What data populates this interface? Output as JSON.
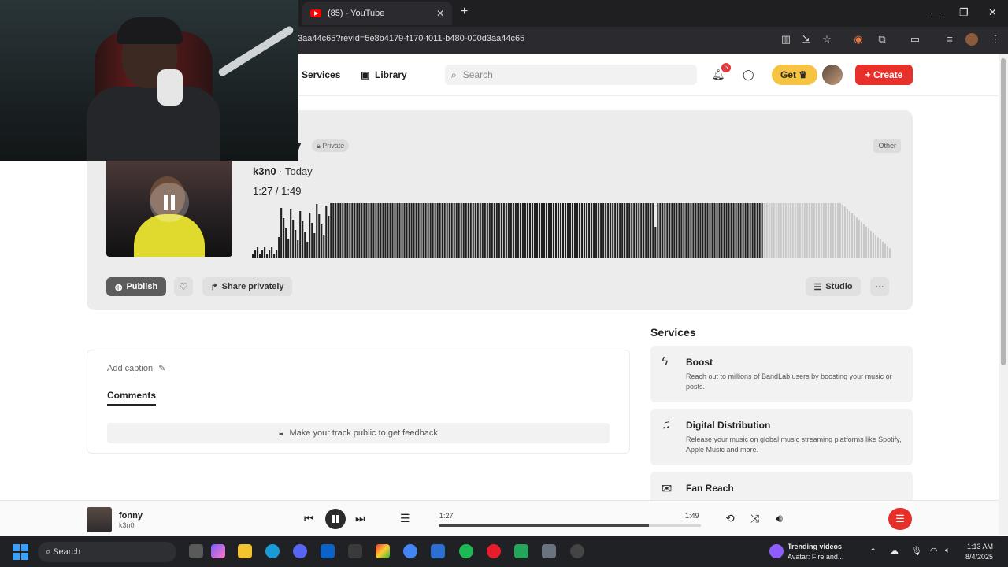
{
  "browser": {
    "tab_title": "(85) - YouTube",
    "tab_close": "✕",
    "new_tab": "+",
    "url": "3aa44c65?revId=5e8b4179-f170-f011-b480-000d3aa44c65",
    "window_controls": [
      "—",
      "❐",
      "✕"
    ]
  },
  "nav": {
    "services": "Services",
    "library": "Library",
    "search_placeholder": "Search",
    "notification_count": "5",
    "get_label": "Get",
    "create_label": "+ Create"
  },
  "track": {
    "title_fragment": "y",
    "privacy": "Private",
    "category": "Other",
    "artist": "k3n0",
    "date": "· Today",
    "current_time": "1:27",
    "total_time": "1:49",
    "progress_fraction": 0.8
  },
  "actions": {
    "publish": "Publish",
    "share": "Share privately",
    "studio": "Studio",
    "more": "···"
  },
  "caption": {
    "add_caption": "Add caption",
    "comments_tab": "Comments",
    "feedback": "Make your track public to get feedback"
  },
  "services": {
    "title": "Services",
    "items": [
      {
        "name": "Boost",
        "desc": "Reach out to millions of BandLab users by boosting your music or posts.",
        "icon": "lightning-icon"
      },
      {
        "name": "Digital Distribution",
        "desc": "Release your music on global music streaming platforms like Spotify, Apple Music and more.",
        "icon": "distribution-icon"
      },
      {
        "name": "Fan Reach",
        "desc": "",
        "icon": "mail-icon"
      }
    ]
  },
  "player": {
    "title": "fonny",
    "artist": "k3n0",
    "current_time": "1:27",
    "total_time": "1:49",
    "progress_fraction": 0.8
  },
  "taskbar": {
    "search": "Search",
    "trending_title": "Trending videos",
    "trending_sub": "Avatar: Fire and...",
    "time": "1:13 AM",
    "date": "8/4/2025"
  },
  "colors": {
    "accent": "#e8302a",
    "get_yellow": "#f6c343",
    "wave_played": "#1f1f1f",
    "wave_unplayed": "#c8c8c8"
  }
}
